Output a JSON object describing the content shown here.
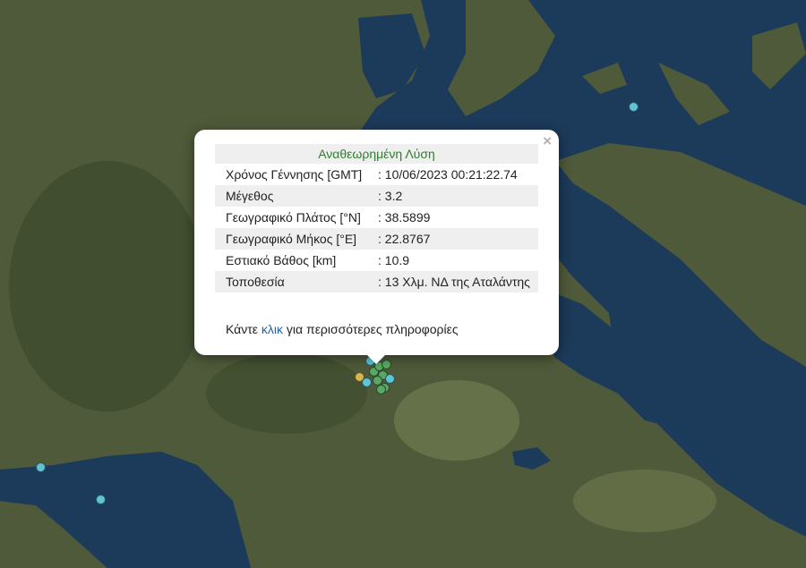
{
  "map": {
    "colors": {
      "sea": "#1c3a5a",
      "land": "#4f5a3a",
      "plain": "#6f7a4e",
      "mountain": "#3c4a2c"
    },
    "markers": [
      {
        "category": "cyan",
        "color": "#5ec4d6"
      },
      {
        "category": "green",
        "color": "#5aa863"
      },
      {
        "category": "yellow",
        "color": "#d4b64a"
      }
    ]
  },
  "popup": {
    "title": "Αναθεωρημένη Λύση",
    "close_symbol": "×",
    "rows": [
      {
        "label": "Χρόνος Γέννησης [GMT]",
        "value": ": 10/06/2023 00:21:22.74"
      },
      {
        "label": "Μέγεθος",
        "value": ": 3.2"
      },
      {
        "label": "Γεωγραφικό Πλάτος [°N]",
        "value": ": 38.5899"
      },
      {
        "label": "Γεωγραφικό Μήκος [°E]",
        "value": ": 22.8767"
      },
      {
        "label": "Εστιακό Βάθος [km]",
        "value": ": 10.9"
      },
      {
        "label": "Τοποθεσία",
        "value": ": 13 Χλμ. ΝΔ της Αταλάντης"
      }
    ],
    "more_prefix": "Κάντε ",
    "more_link": "κλικ",
    "more_suffix": " για περισσότερες πληροφορίες"
  }
}
